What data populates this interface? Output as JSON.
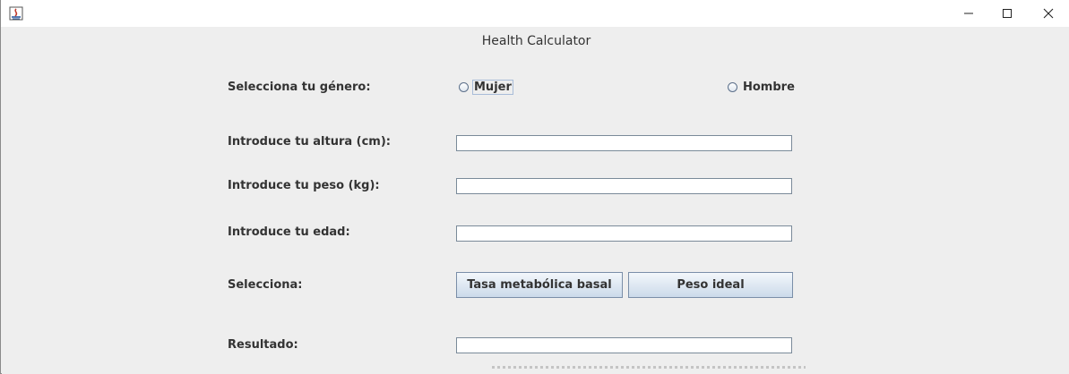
{
  "window": {
    "title": "Health Calculator",
    "app_icon": "java-icon",
    "controls": [
      "minimize-icon",
      "maximize-icon",
      "close-icon"
    ]
  },
  "form": {
    "gender": {
      "label": "Selecciona tu género:",
      "options": [
        {
          "label": "Mujer",
          "selected": false,
          "focused": true
        },
        {
          "label": "Hombre",
          "selected": false,
          "focused": false
        }
      ]
    },
    "height": {
      "label": "Introduce tu altura (cm):",
      "value": ""
    },
    "weight": {
      "label": "Introduce tu peso (kg):",
      "value": ""
    },
    "age": {
      "label": "Introduce tu edad:",
      "value": ""
    },
    "select": {
      "label": "Selecciona:",
      "buttons": [
        "Tasa metabólica basal",
        "Peso ideal"
      ]
    },
    "result": {
      "label": "Resultado:",
      "value": ""
    }
  }
}
